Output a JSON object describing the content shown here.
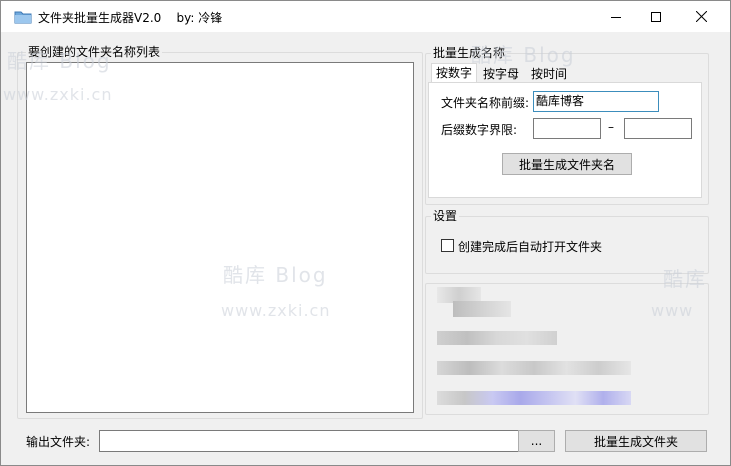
{
  "window": {
    "title": "文件夹批量生成器V2.0    by: 冷锋"
  },
  "list_panel": {
    "label": "要创建的文件夹名称列表",
    "items": []
  },
  "batch_group": {
    "label": "批量生成名称",
    "tabs": [
      {
        "label": "按数字",
        "active": true
      },
      {
        "label": "按字母",
        "active": false
      },
      {
        "label": "按时间",
        "active": false
      }
    ],
    "prefix_label": "文件夹名称前缀:",
    "prefix_value": "酷库博客",
    "range_label": "后缀数字界限:",
    "range_start": "",
    "range_dash": "–",
    "range_end": "",
    "generate_names_button": "批量生成文件夹名"
  },
  "settings_group": {
    "label": "设置",
    "auto_open_label": "创建完成后自动打开文件夹",
    "auto_open_checked": false
  },
  "output": {
    "label": "输出文件夹:",
    "path_value": "",
    "browse_button": "...",
    "generate_folders_button": "批量生成文件夹"
  },
  "watermark": {
    "brand": "酷库 Blog",
    "url": "www.zxki.cn"
  },
  "colors": {
    "window_bg": "#f0f0f0",
    "title_bg": "#ffffff",
    "focus_border": "#3c8dbc",
    "watermark": "#c8cdd7"
  }
}
